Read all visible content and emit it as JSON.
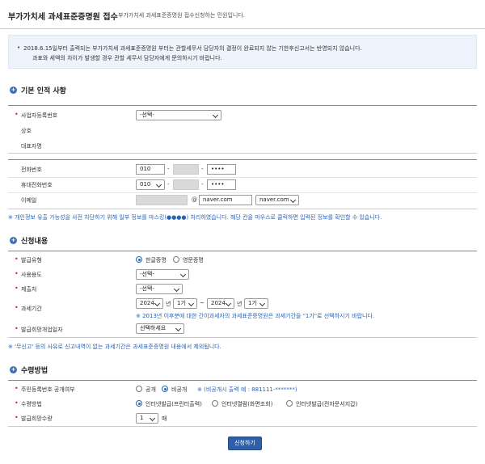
{
  "header": {
    "title": "부가가치세 과세표준증명원 접수",
    "subtitle": "부가가치세 과세표준증명원 접수신청하는 민원입니다."
  },
  "notice": {
    "line1": "2018.6.15일부터 출력되는 부가가치세 과세표준증명원 부터는 관할세무서 담당자의 결정이 완료되지 않는 기한후신고서는 반영되지 않습니다.",
    "line2": "과표와 세액의 차이가 발생할 경우 관할 세무서 담당자에게 문의하시기 바랍니다."
  },
  "section1": {
    "title": "기본 인적 사항",
    "biz_no_label": "사업자등록번호",
    "biz_no_select": "-선택-",
    "company_label": "상호",
    "rep_label": "대표자명",
    "phone_label": "전화번호",
    "phone_prefix": "010",
    "phone_last": "••••",
    "mobile_label": "휴대전화번호",
    "mobile_prefix": "010",
    "mobile_last": "••••",
    "email_label": "이메일",
    "email_at": "@",
    "email_domain": "naver.com",
    "email_domain_select": "naver.com",
    "dash": "-",
    "privacy_note": "※ 개인정보 유출 가능성을 사전 차단하기 위해 일부 정보를 마스킹(●●●●) 처리하였습니다. 해당 칸을 마우스로 클릭하면 입력된 정보를 확인할 수 있습니다."
  },
  "section2": {
    "title": "신청내용",
    "issue_type_label": "발급유형",
    "issue_type_opt1": "한글증명",
    "issue_type_opt2": "영문증명",
    "usage_label": "사용용도",
    "usage_select": "-선택-",
    "submit_to_label": "제출처",
    "submit_to_select": "-선택-",
    "period_label": "과세기간",
    "period_from_year": "2024",
    "period_from_unit": "1기",
    "period_to_year": "2024",
    "period_to_unit": "1기",
    "year_suffix": "년",
    "tilde": "~",
    "period_hint": "※ 2013년 이후분에 대한 간이과세자의 과세표준증명원은 과세기간을 \"1기\"로 선택하시기 바랍니다.",
    "request_date_label": "발급희망개업일자",
    "request_date_select": "선택하세요",
    "note": "※ '무신고' 등의 사유로 신고내역이 없는 과세기간은 과세표준증명원 내용에서 제외됩니다."
  },
  "section3": {
    "title": "수령방법",
    "rrn_label": "주민등록번호 공개여부",
    "rrn_opt1": "공개",
    "rrn_opt2": "비공개",
    "rrn_hint": "※ (비공개시 출력 예 : 881111-*******)",
    "method_label": "수령방법",
    "method_opt1": "인터넷발급(프린터출력)",
    "method_opt2": "인터넷열람(화면조회)",
    "method_opt3": "인터넷발급(전자문서지갑)",
    "qty_label": "발급희망수량",
    "qty_value": "1",
    "qty_unit": "매"
  },
  "submit_label": "신청하기",
  "colors": {
    "accent": "#2f5fa8",
    "required": "#d02020",
    "hint": "#2a64b8"
  }
}
